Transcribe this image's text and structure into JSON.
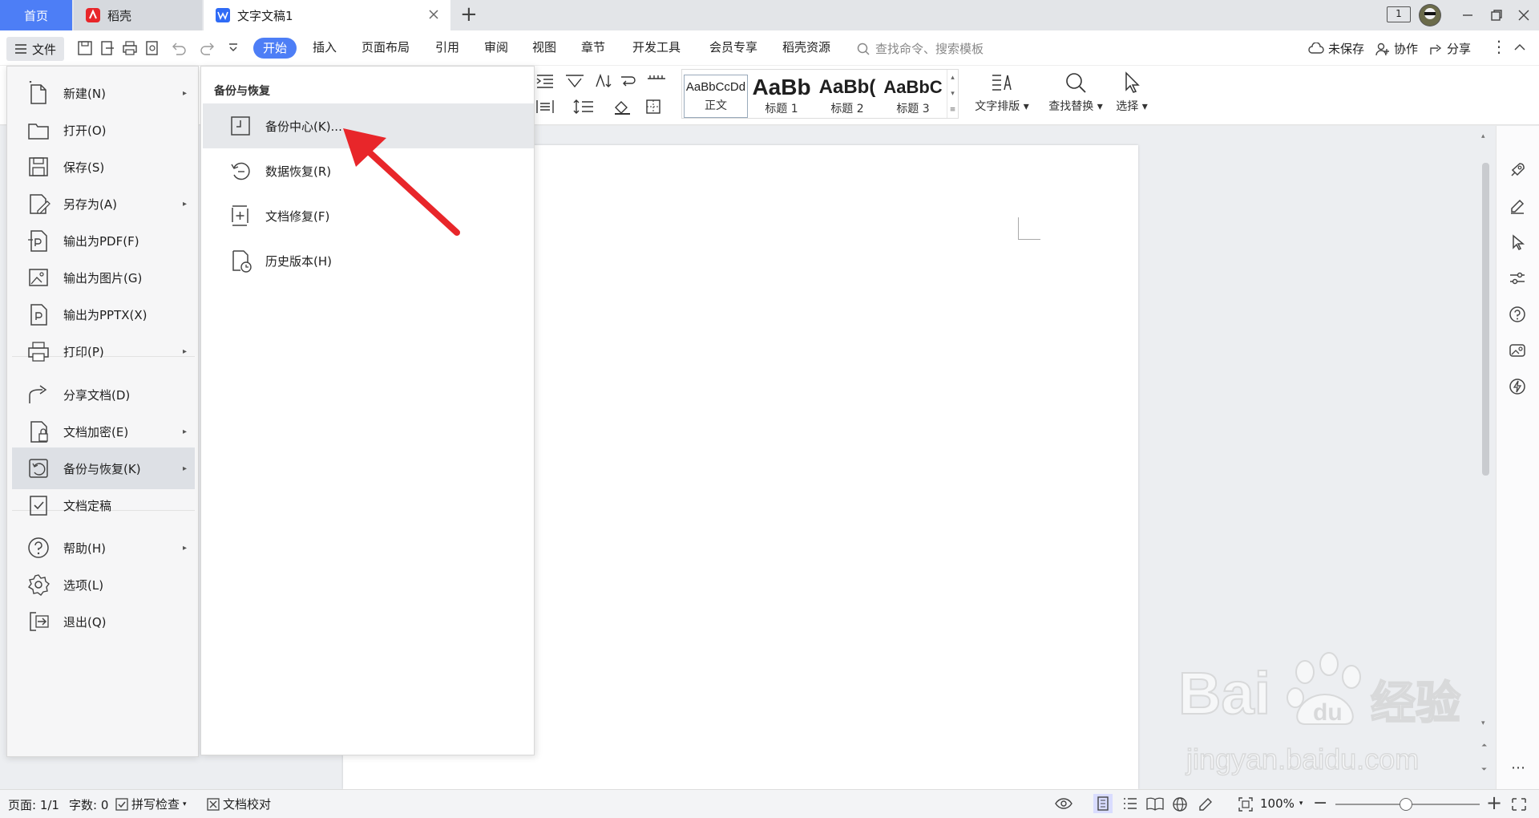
{
  "titlebar": {
    "tabs": [
      {
        "label": "首页"
      },
      {
        "label": "稻壳"
      },
      {
        "label": "文字文稿1"
      }
    ],
    "add_tab": "+",
    "page_badge": "1"
  },
  "menubar": {
    "file_label": "文件",
    "tabs": [
      "开始",
      "插入",
      "页面布局",
      "引用",
      "审阅",
      "视图",
      "章节",
      "开发工具",
      "会员专享",
      "稻壳资源"
    ],
    "search_placeholder": "查找命令、搜索模板",
    "unsaved": "未保存",
    "collab": "协作",
    "share": "分享"
  },
  "ribbon": {
    "styles": [
      {
        "preview": "AaBbCcDd",
        "name": "正文"
      },
      {
        "preview": "AaBb",
        "name": "标题 1"
      },
      {
        "preview": "AaBb(",
        "name": "标题 2"
      },
      {
        "preview": "AaBbC",
        "name": "标题 3"
      }
    ],
    "text_layout": "文字排版",
    "find_replace": "查找替换",
    "select": "选择"
  },
  "file_menu": {
    "items": [
      {
        "label": "新建(N)",
        "icon": "new-doc-icon",
        "submenu": true
      },
      {
        "label": "打开(O)",
        "icon": "folder-icon",
        "submenu": false
      },
      {
        "label": "保存(S)",
        "icon": "save-icon",
        "submenu": false
      },
      {
        "label": "另存为(A)",
        "icon": "save-as-icon",
        "submenu": true
      },
      {
        "label": "输出为PDF(F)",
        "icon": "pdf-icon",
        "submenu": false
      },
      {
        "label": "输出为图片(G)",
        "icon": "image-icon",
        "submenu": false
      },
      {
        "label": "输出为PPTX(X)",
        "icon": "pptx-icon",
        "submenu": false
      },
      {
        "label": "打印(P)",
        "icon": "print-icon",
        "submenu": true
      },
      {
        "label": "分享文档(D)",
        "icon": "share-icon",
        "submenu": false
      },
      {
        "label": "文档加密(E)",
        "icon": "encrypt-icon",
        "submenu": true
      },
      {
        "label": "备份与恢复(K)",
        "icon": "backup-icon",
        "submenu": true
      },
      {
        "label": "文档定稿",
        "icon": "finalize-icon",
        "submenu": false
      },
      {
        "label": "帮助(H)",
        "icon": "help-icon",
        "submenu": true
      },
      {
        "label": "选项(L)",
        "icon": "gear-icon",
        "submenu": false
      },
      {
        "label": "退出(Q)",
        "icon": "exit-icon",
        "submenu": false
      }
    ],
    "selected": "备份与恢复(K)"
  },
  "submenu": {
    "title": "备份与恢复",
    "items": [
      {
        "label": "备份中心(K)...",
        "icon": "backup-center-icon"
      },
      {
        "label": "数据恢复(R)",
        "icon": "data-restore-icon"
      },
      {
        "label": "文档修复(F)",
        "icon": "doc-repair-icon"
      },
      {
        "label": "历史版本(H)",
        "icon": "history-icon"
      }
    ],
    "highlighted": "备份中心(K)..."
  },
  "statusbar": {
    "page": "页面: 1/1",
    "words": "字数: 0",
    "spellcheck": "拼写检查",
    "proof": "文档校对",
    "zoom": "100%"
  },
  "watermark": {
    "text1": "Bai",
    "text2": "经验",
    "text3": "jingyan.baidu.com"
  },
  "colors": {
    "accent": "#4d7ef6",
    "arrow": "#e8262a"
  }
}
